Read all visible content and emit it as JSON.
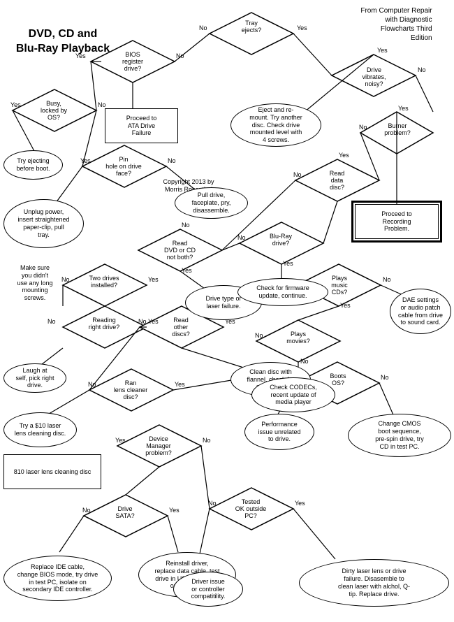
{
  "title": "DVD, CD and Blu-Ray Playback",
  "source": "From Computer Repair\nwith Diagnostic\nFlowcharts Third\nEdition",
  "copyright": "Copyright 2013 by\nMorris Rosenthal",
  "nodes": {
    "title": "DVD, CD and\nBlu-Ray Playback",
    "tray_ejects": "Tray\nejects?",
    "drive_vibrates": "Drive\nvibrates,\nnoisy?",
    "bios_register": "BIOS\nregister\ndrive?",
    "busy_locked": "Busy,\nlocked by\nOS?",
    "proceed_ata": "Proceed to\nATA Drive\nFailure",
    "try_ejecting": "Try ejecting\nbefore boot.",
    "eject_remount": "Eject and re-\nmount. Try another\ndisc. Check drive\nmounted level with\n4 screws.",
    "burner_problem": "Burner\nproblem?",
    "pin_hole": "Pin\nhole on drive\nface?",
    "unplug_power": "Unplug power,\ninsert straightened\npaper-clip, pull\ntray.",
    "pull_drive": "Pull drive,\nfaceplate, pry,\ndisassemble.",
    "read_data_disc": "Read\ndata\ndisc?",
    "proceed_recording": "Proceed to\nRecording\nProblem.",
    "make_sure": "Make sure\nyou didn't\nuse any long\nmounting\nscrews.",
    "read_dvd_cd": "Read\nDVD or CD\nnot both?",
    "blu_ray_drive": "Blu-Ray\ndrive?",
    "check_firmware": "Check for firmware\nupdate, continue.",
    "drive_type_laser": "Drive type or\nlaser failure.",
    "two_drives": "Two drives\ninstalled?",
    "plays_music": "Plays\nmusic\nCDs?",
    "dae_settings": "DAE settings\nor audio patch\ncable from drive\nto sound card.",
    "reading_right": "Reading\nright drive?",
    "read_other_discs": "Read\nother\ndiscs?",
    "plays_movies": "Plays\nmovies?",
    "laugh_self": "Laugh at\nself, pick right\ndrive.",
    "check_codecs": "Check CODECs,\nrecent update of\nmedia player",
    "ran_lens_cleaner": "Ran\nlens cleaner\ndisc?",
    "clean_disc": "Clean disc with\nflannel, check for\nscratches.",
    "boots_os": "Boots\nOS?",
    "try_laser_disc": "Try a $10 laser\nlens cleaning disc.",
    "device_manager": "Device\nManager\nproblem?",
    "performance_issue": "Performance\nissue unrelated\nto drive.",
    "change_cmos": "Change CMOS\nboot sequence,\npre-spin drive, try\nCD in test PC.",
    "drive_sata": "Drive\nSATA?",
    "reinstall_driver": "Reinstall driver,\nreplace data cable, test\ndrive in USB enclosure\nor other PC.",
    "tested_ok": "Tested\nOK outside\nPC?",
    "replace_ide": "Replace IDE cable,\nchange BIOS mode, try drive\nin test PC, isolate on\nsecondary IDE controller.",
    "driver_issue": "Driver issue\nor controller\ncompatitility.",
    "dirty_laser": "Dirty laser lens or drive\nfailure. Disasemble to\nclean laser with alchol, Q-\ntip. Replace drive.",
    "810_laser": "810 laser lens cleaning disc"
  }
}
